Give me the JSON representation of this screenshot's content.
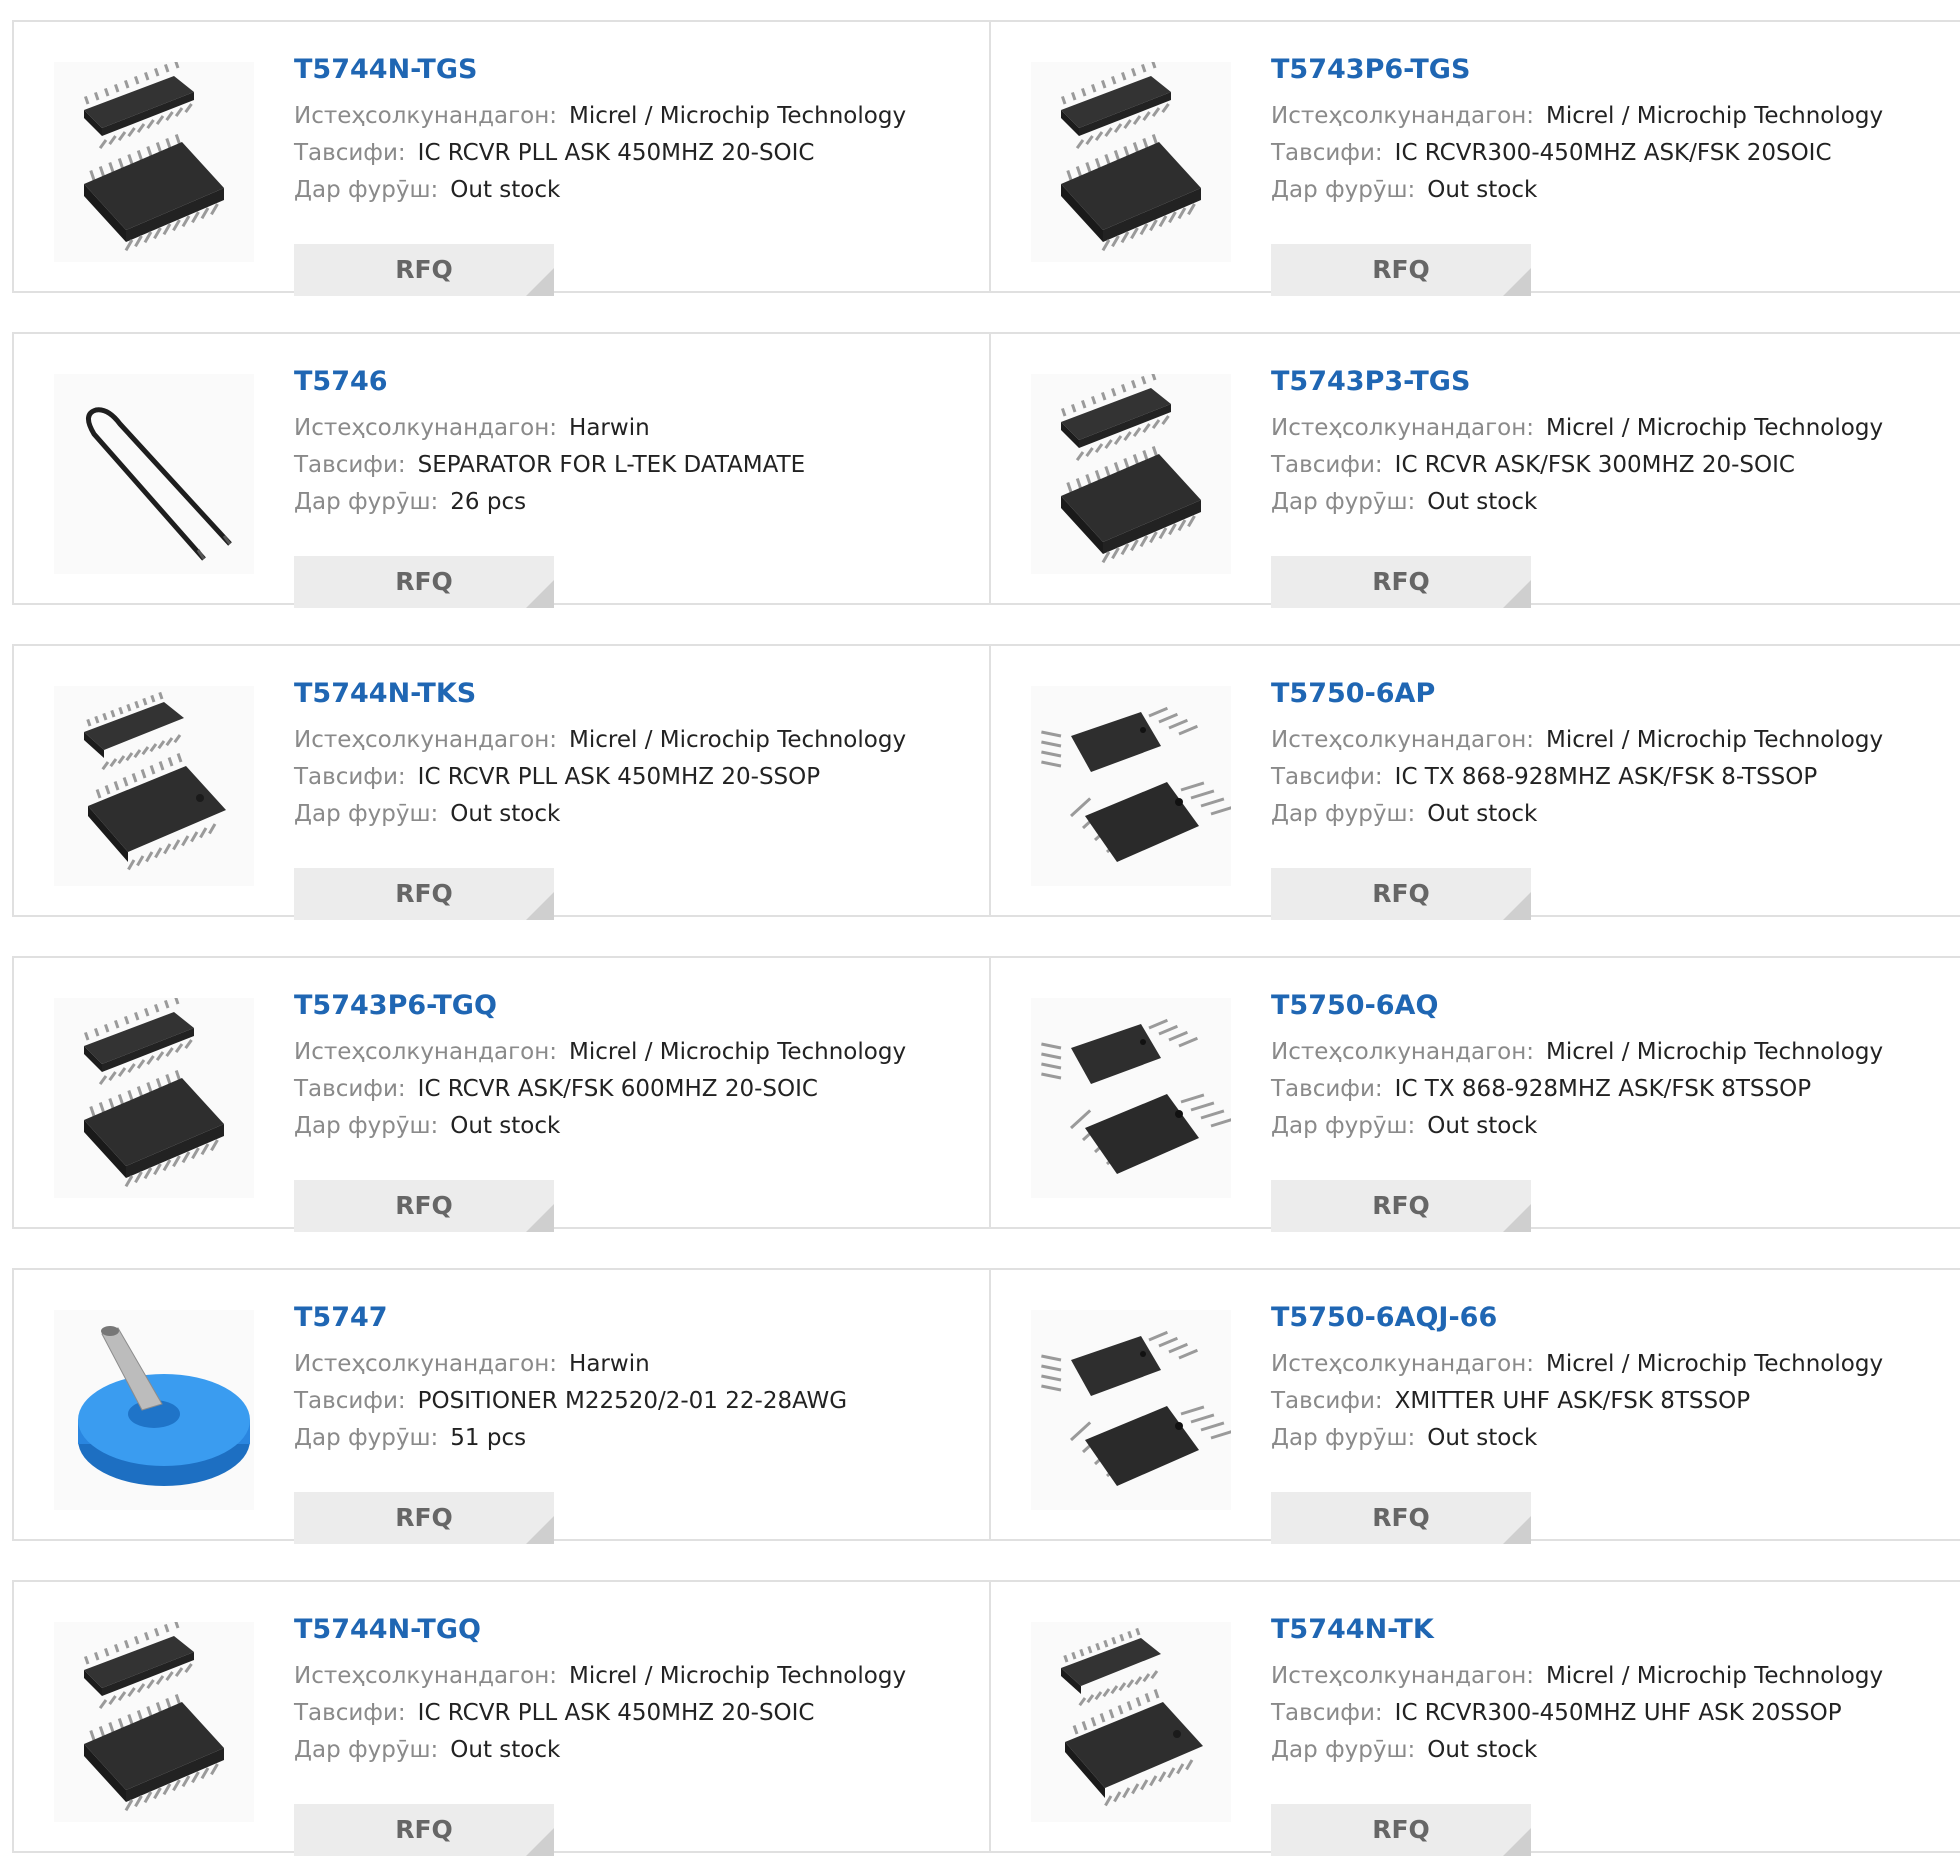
{
  "labels": {
    "manufacturer": "Истеҳсолкунандагон:",
    "description": "Тавсифи:",
    "stock": "Дар фурӯш:",
    "rfq": "RFQ"
  },
  "products": [
    {
      "pn": "T5744N-TGS",
      "manufacturer": "Micrel / Microchip Technology",
      "description": "IC RCVR PLL ASK 450MHZ 20-SOIC",
      "stock": "Out stock",
      "image": "soic20-chip-image"
    },
    {
      "pn": "T5743P6-TGS",
      "manufacturer": "Micrel / Microchip Technology",
      "description": "IC RCVR300-450MHZ ASK/FSK 20SOIC",
      "stock": "Out stock",
      "image": "soic20-chip-image"
    },
    {
      "pn": "T5746",
      "manufacturer": "Harwin",
      "description": "SEPARATOR FOR L-TEK DATAMATE",
      "stock": "26 pcs",
      "image": "separator-tool-image"
    },
    {
      "pn": "T5743P3-TGS",
      "manufacturer": "Micrel / Microchip Technology",
      "description": "IC RCVR ASK/FSK 300MHZ 20-SOIC",
      "stock": "Out stock",
      "image": "soic20-chip-image"
    },
    {
      "pn": "T5744N-TKS",
      "manufacturer": "Micrel / Microchip Technology",
      "description": "IC RCVR PLL ASK 450MHZ 20-SSOP",
      "stock": "Out stock",
      "image": "ssop20-chip-image"
    },
    {
      "pn": "T5750-6AP",
      "manufacturer": "Micrel / Microchip Technology",
      "description": "IC TX 868-928MHZ ASK/FSK 8-TSSOP",
      "stock": "Out stock",
      "image": "tssop8-chip-image"
    },
    {
      "pn": "T5743P6-TGQ",
      "manufacturer": "Micrel / Microchip Technology",
      "description": "IC RCVR ASK/FSK 600MHZ 20-SOIC",
      "stock": "Out stock",
      "image": "soic20-chip-image"
    },
    {
      "pn": "T5750-6AQ",
      "manufacturer": "Micrel / Microchip Technology",
      "description": "IC TX 868-928MHZ ASK/FSK 8TSSOP",
      "stock": "Out stock",
      "image": "tssop8-chip-image"
    },
    {
      "pn": "T5747",
      "manufacturer": "Harwin",
      "description": "POSITIONER M22520/2-01 22-28AWG",
      "stock": "51 pcs",
      "image": "positioner-image"
    },
    {
      "pn": "T5750-6AQJ-66",
      "manufacturer": "Micrel / Microchip Technology",
      "description": "XMITTER UHF ASK/FSK 8TSSOP",
      "stock": "Out stock",
      "image": "tssop8-chip-image"
    },
    {
      "pn": "T5744N-TGQ",
      "manufacturer": "Micrel / Microchip Technology",
      "description": "IC RCVR PLL ASK 450MHZ 20-SOIC",
      "stock": "Out stock",
      "image": "soic20-chip-image"
    },
    {
      "pn": "T5744N-TK",
      "manufacturer": "Micrel / Microchip Technology",
      "description": "IC RCVR300-450MHZ UHF ASK 20SSOP",
      "stock": "Out stock",
      "image": "ssop20-chip-image"
    }
  ]
}
